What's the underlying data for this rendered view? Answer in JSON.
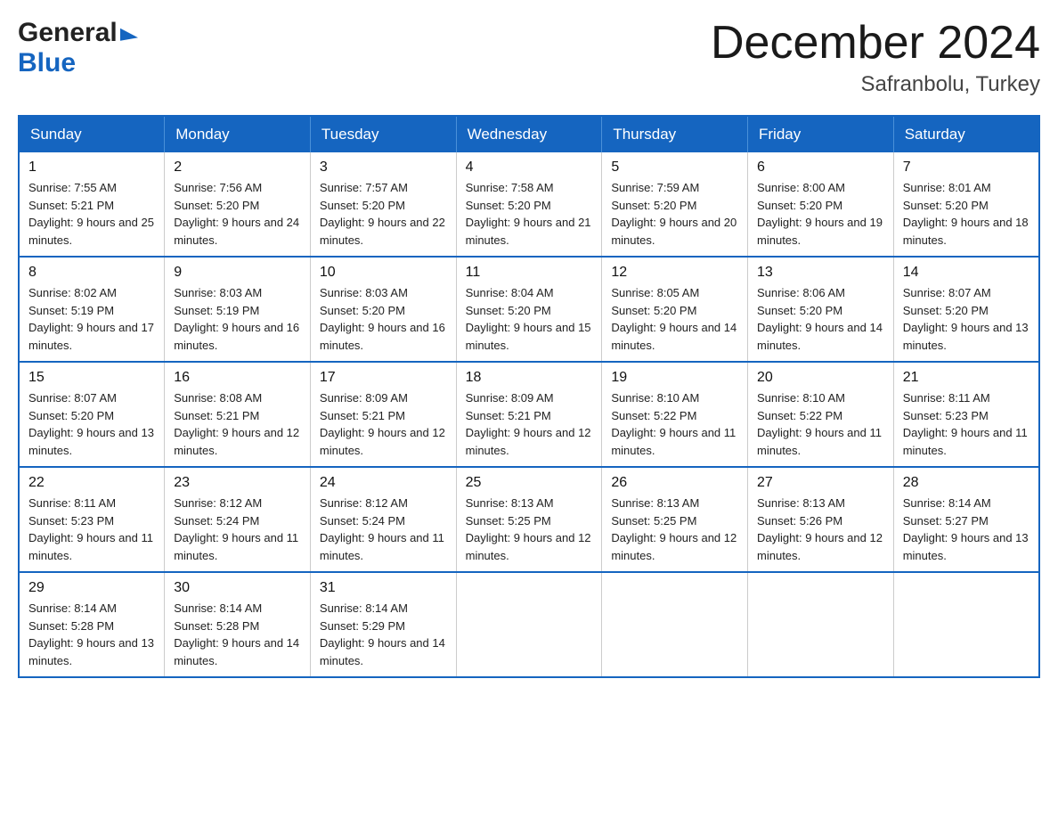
{
  "header": {
    "logo_general": "General",
    "logo_blue": "Blue",
    "title": "December 2024",
    "subtitle": "Safranbolu, Turkey"
  },
  "days_of_week": [
    "Sunday",
    "Monday",
    "Tuesday",
    "Wednesday",
    "Thursday",
    "Friday",
    "Saturday"
  ],
  "weeks": [
    [
      {
        "day": "1",
        "sunrise": "7:55 AM",
        "sunset": "5:21 PM",
        "daylight": "9 hours and 25 minutes."
      },
      {
        "day": "2",
        "sunrise": "7:56 AM",
        "sunset": "5:20 PM",
        "daylight": "9 hours and 24 minutes."
      },
      {
        "day": "3",
        "sunrise": "7:57 AM",
        "sunset": "5:20 PM",
        "daylight": "9 hours and 22 minutes."
      },
      {
        "day": "4",
        "sunrise": "7:58 AM",
        "sunset": "5:20 PM",
        "daylight": "9 hours and 21 minutes."
      },
      {
        "day": "5",
        "sunrise": "7:59 AM",
        "sunset": "5:20 PM",
        "daylight": "9 hours and 20 minutes."
      },
      {
        "day": "6",
        "sunrise": "8:00 AM",
        "sunset": "5:20 PM",
        "daylight": "9 hours and 19 minutes."
      },
      {
        "day": "7",
        "sunrise": "8:01 AM",
        "sunset": "5:20 PM",
        "daylight": "9 hours and 18 minutes."
      }
    ],
    [
      {
        "day": "8",
        "sunrise": "8:02 AM",
        "sunset": "5:19 PM",
        "daylight": "9 hours and 17 minutes."
      },
      {
        "day": "9",
        "sunrise": "8:03 AM",
        "sunset": "5:19 PM",
        "daylight": "9 hours and 16 minutes."
      },
      {
        "day": "10",
        "sunrise": "8:03 AM",
        "sunset": "5:20 PM",
        "daylight": "9 hours and 16 minutes."
      },
      {
        "day": "11",
        "sunrise": "8:04 AM",
        "sunset": "5:20 PM",
        "daylight": "9 hours and 15 minutes."
      },
      {
        "day": "12",
        "sunrise": "8:05 AM",
        "sunset": "5:20 PM",
        "daylight": "9 hours and 14 minutes."
      },
      {
        "day": "13",
        "sunrise": "8:06 AM",
        "sunset": "5:20 PM",
        "daylight": "9 hours and 14 minutes."
      },
      {
        "day": "14",
        "sunrise": "8:07 AM",
        "sunset": "5:20 PM",
        "daylight": "9 hours and 13 minutes."
      }
    ],
    [
      {
        "day": "15",
        "sunrise": "8:07 AM",
        "sunset": "5:20 PM",
        "daylight": "9 hours and 13 minutes."
      },
      {
        "day": "16",
        "sunrise": "8:08 AM",
        "sunset": "5:21 PM",
        "daylight": "9 hours and 12 minutes."
      },
      {
        "day": "17",
        "sunrise": "8:09 AM",
        "sunset": "5:21 PM",
        "daylight": "9 hours and 12 minutes."
      },
      {
        "day": "18",
        "sunrise": "8:09 AM",
        "sunset": "5:21 PM",
        "daylight": "9 hours and 12 minutes."
      },
      {
        "day": "19",
        "sunrise": "8:10 AM",
        "sunset": "5:22 PM",
        "daylight": "9 hours and 11 minutes."
      },
      {
        "day": "20",
        "sunrise": "8:10 AM",
        "sunset": "5:22 PM",
        "daylight": "9 hours and 11 minutes."
      },
      {
        "day": "21",
        "sunrise": "8:11 AM",
        "sunset": "5:23 PM",
        "daylight": "9 hours and 11 minutes."
      }
    ],
    [
      {
        "day": "22",
        "sunrise": "8:11 AM",
        "sunset": "5:23 PM",
        "daylight": "9 hours and 11 minutes."
      },
      {
        "day": "23",
        "sunrise": "8:12 AM",
        "sunset": "5:24 PM",
        "daylight": "9 hours and 11 minutes."
      },
      {
        "day": "24",
        "sunrise": "8:12 AM",
        "sunset": "5:24 PM",
        "daylight": "9 hours and 11 minutes."
      },
      {
        "day": "25",
        "sunrise": "8:13 AM",
        "sunset": "5:25 PM",
        "daylight": "9 hours and 12 minutes."
      },
      {
        "day": "26",
        "sunrise": "8:13 AM",
        "sunset": "5:25 PM",
        "daylight": "9 hours and 12 minutes."
      },
      {
        "day": "27",
        "sunrise": "8:13 AM",
        "sunset": "5:26 PM",
        "daylight": "9 hours and 12 minutes."
      },
      {
        "day": "28",
        "sunrise": "8:14 AM",
        "sunset": "5:27 PM",
        "daylight": "9 hours and 13 minutes."
      }
    ],
    [
      {
        "day": "29",
        "sunrise": "8:14 AM",
        "sunset": "5:28 PM",
        "daylight": "9 hours and 13 minutes."
      },
      {
        "day": "30",
        "sunrise": "8:14 AM",
        "sunset": "5:28 PM",
        "daylight": "9 hours and 14 minutes."
      },
      {
        "day": "31",
        "sunrise": "8:14 AM",
        "sunset": "5:29 PM",
        "daylight": "9 hours and 14 minutes."
      },
      null,
      null,
      null,
      null
    ]
  ]
}
